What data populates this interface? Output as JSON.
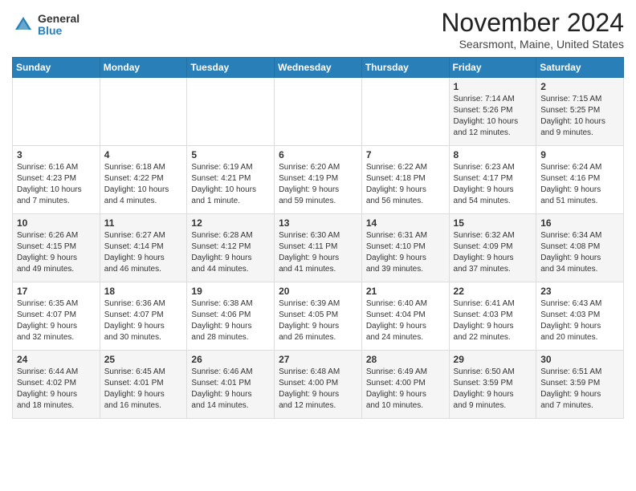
{
  "logo": {
    "general": "General",
    "blue": "Blue"
  },
  "header": {
    "month_year": "November 2024",
    "location": "Searsmont, Maine, United States"
  },
  "weekdays": [
    "Sunday",
    "Monday",
    "Tuesday",
    "Wednesday",
    "Thursday",
    "Friday",
    "Saturday"
  ],
  "weeks": [
    [
      {
        "day": "",
        "info": ""
      },
      {
        "day": "",
        "info": ""
      },
      {
        "day": "",
        "info": ""
      },
      {
        "day": "",
        "info": ""
      },
      {
        "day": "",
        "info": ""
      },
      {
        "day": "1",
        "info": "Sunrise: 7:14 AM\nSunset: 5:26 PM\nDaylight: 10 hours\nand 12 minutes."
      },
      {
        "day": "2",
        "info": "Sunrise: 7:15 AM\nSunset: 5:25 PM\nDaylight: 10 hours\nand 9 minutes."
      }
    ],
    [
      {
        "day": "3",
        "info": "Sunrise: 6:16 AM\nSunset: 4:23 PM\nDaylight: 10 hours\nand 7 minutes."
      },
      {
        "day": "4",
        "info": "Sunrise: 6:18 AM\nSunset: 4:22 PM\nDaylight: 10 hours\nand 4 minutes."
      },
      {
        "day": "5",
        "info": "Sunrise: 6:19 AM\nSunset: 4:21 PM\nDaylight: 10 hours\nand 1 minute."
      },
      {
        "day": "6",
        "info": "Sunrise: 6:20 AM\nSunset: 4:19 PM\nDaylight: 9 hours\nand 59 minutes."
      },
      {
        "day": "7",
        "info": "Sunrise: 6:22 AM\nSunset: 4:18 PM\nDaylight: 9 hours\nand 56 minutes."
      },
      {
        "day": "8",
        "info": "Sunrise: 6:23 AM\nSunset: 4:17 PM\nDaylight: 9 hours\nand 54 minutes."
      },
      {
        "day": "9",
        "info": "Sunrise: 6:24 AM\nSunset: 4:16 PM\nDaylight: 9 hours\nand 51 minutes."
      }
    ],
    [
      {
        "day": "10",
        "info": "Sunrise: 6:26 AM\nSunset: 4:15 PM\nDaylight: 9 hours\nand 49 minutes."
      },
      {
        "day": "11",
        "info": "Sunrise: 6:27 AM\nSunset: 4:14 PM\nDaylight: 9 hours\nand 46 minutes."
      },
      {
        "day": "12",
        "info": "Sunrise: 6:28 AM\nSunset: 4:12 PM\nDaylight: 9 hours\nand 44 minutes."
      },
      {
        "day": "13",
        "info": "Sunrise: 6:30 AM\nSunset: 4:11 PM\nDaylight: 9 hours\nand 41 minutes."
      },
      {
        "day": "14",
        "info": "Sunrise: 6:31 AM\nSunset: 4:10 PM\nDaylight: 9 hours\nand 39 minutes."
      },
      {
        "day": "15",
        "info": "Sunrise: 6:32 AM\nSunset: 4:09 PM\nDaylight: 9 hours\nand 37 minutes."
      },
      {
        "day": "16",
        "info": "Sunrise: 6:34 AM\nSunset: 4:08 PM\nDaylight: 9 hours\nand 34 minutes."
      }
    ],
    [
      {
        "day": "17",
        "info": "Sunrise: 6:35 AM\nSunset: 4:07 PM\nDaylight: 9 hours\nand 32 minutes."
      },
      {
        "day": "18",
        "info": "Sunrise: 6:36 AM\nSunset: 4:07 PM\nDaylight: 9 hours\nand 30 minutes."
      },
      {
        "day": "19",
        "info": "Sunrise: 6:38 AM\nSunset: 4:06 PM\nDaylight: 9 hours\nand 28 minutes."
      },
      {
        "day": "20",
        "info": "Sunrise: 6:39 AM\nSunset: 4:05 PM\nDaylight: 9 hours\nand 26 minutes."
      },
      {
        "day": "21",
        "info": "Sunrise: 6:40 AM\nSunset: 4:04 PM\nDaylight: 9 hours\nand 24 minutes."
      },
      {
        "day": "22",
        "info": "Sunrise: 6:41 AM\nSunset: 4:03 PM\nDaylight: 9 hours\nand 22 minutes."
      },
      {
        "day": "23",
        "info": "Sunrise: 6:43 AM\nSunset: 4:03 PM\nDaylight: 9 hours\nand 20 minutes."
      }
    ],
    [
      {
        "day": "24",
        "info": "Sunrise: 6:44 AM\nSunset: 4:02 PM\nDaylight: 9 hours\nand 18 minutes."
      },
      {
        "day": "25",
        "info": "Sunrise: 6:45 AM\nSunset: 4:01 PM\nDaylight: 9 hours\nand 16 minutes."
      },
      {
        "day": "26",
        "info": "Sunrise: 6:46 AM\nSunset: 4:01 PM\nDaylight: 9 hours\nand 14 minutes."
      },
      {
        "day": "27",
        "info": "Sunrise: 6:48 AM\nSunset: 4:00 PM\nDaylight: 9 hours\nand 12 minutes."
      },
      {
        "day": "28",
        "info": "Sunrise: 6:49 AM\nSunset: 4:00 PM\nDaylight: 9 hours\nand 10 minutes."
      },
      {
        "day": "29",
        "info": "Sunrise: 6:50 AM\nSunset: 3:59 PM\nDaylight: 9 hours\nand 9 minutes."
      },
      {
        "day": "30",
        "info": "Sunrise: 6:51 AM\nSunset: 3:59 PM\nDaylight: 9 hours\nand 7 minutes."
      }
    ]
  ]
}
